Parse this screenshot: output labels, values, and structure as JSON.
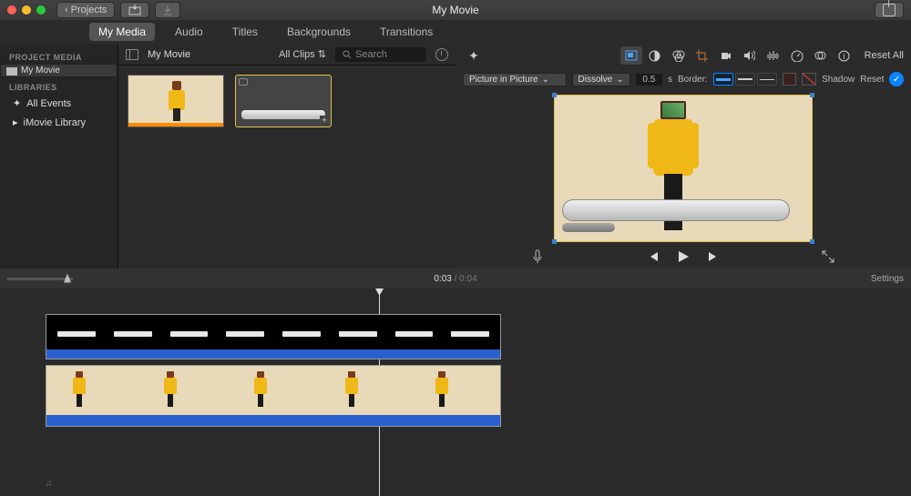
{
  "titlebar": {
    "back": "Projects",
    "title": "My Movie"
  },
  "tabs": [
    "My Media",
    "Audio",
    "Titles",
    "Backgrounds",
    "Transitions"
  ],
  "active_tab_index": 0,
  "sidebar": {
    "section1": "PROJECT MEDIA",
    "item1": "My Movie",
    "section2": "LIBRARIES",
    "item2": "All Events",
    "item3": "iMovie Library"
  },
  "browser": {
    "title": "My Movie",
    "filter": "All Clips",
    "search_placeholder": "Search"
  },
  "viewer": {
    "reset_all": "Reset All",
    "overlay_mode": "Picture in Picture",
    "transition": "Dissolve",
    "duration": "0.5",
    "duration_suffix": "s",
    "border_label": "Border:",
    "shadow": "Shadow",
    "reset": "Reset"
  },
  "timeline": {
    "current": "0:03",
    "duration": "0:04",
    "settings": "Settings"
  }
}
